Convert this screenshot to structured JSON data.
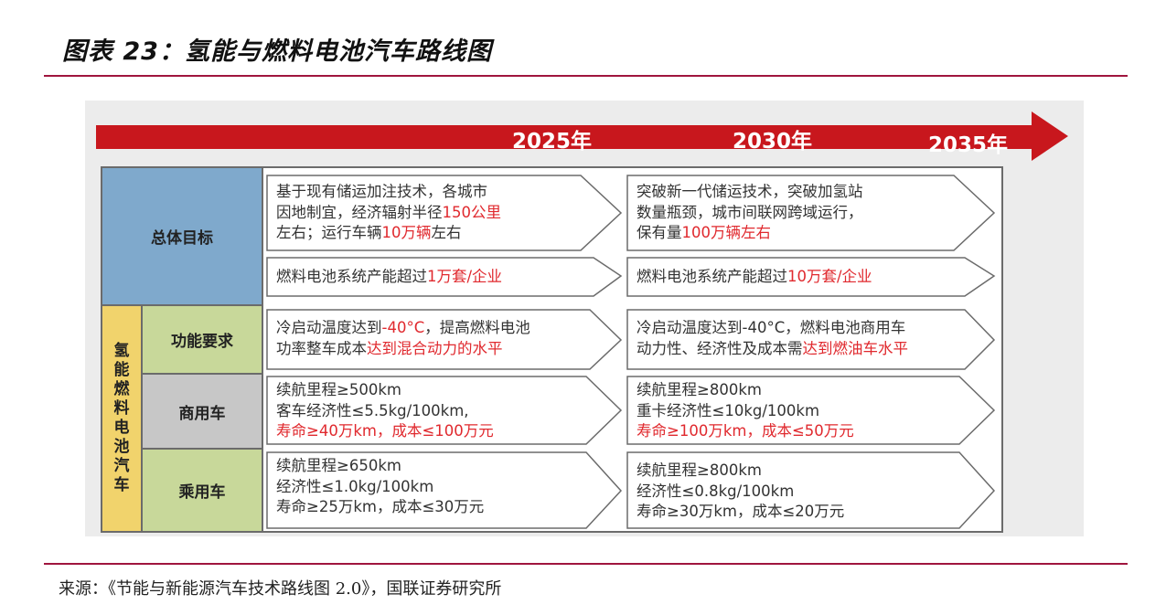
{
  "title": "图表 23：氢能与燃料电池汽车路线图",
  "source": "来源：《节能与新能源汽车技术路线图 2.0》，国联证券研究所",
  "timeline": {
    "years": [
      "2025年",
      "2030年",
      "2035年"
    ]
  },
  "rows": {
    "overall": "总体目标",
    "group_chars": [
      "氢",
      "能",
      "燃",
      "料",
      "电",
      "池",
      "汽",
      "车"
    ],
    "function": "功能要求",
    "commercial": "商用车",
    "passenger": "乘用车"
  },
  "cells": {
    "overall_a_2025": {
      "l1": "基于现有储运加注技术，各城市",
      "l2a": "因地制宜，经济辐射半径",
      "l2b": "150公里",
      "l3a": "左右；运行车辆",
      "l3b": "10万辆",
      "l3c": "左右"
    },
    "overall_a_2030": {
      "l1": "突破新一代储运技术，突破加氢站",
      "l2": "数量瓶颈，城市间联网跨域运行，",
      "l3a": "保有量",
      "l3b": "100万辆左右"
    },
    "overall_b_2025": {
      "a": "燃料电池系统产能超过",
      "b": "1万套/企业"
    },
    "overall_b_2030": {
      "a": "燃料电池系统产能超过",
      "b": "10万套/企业"
    },
    "function_2025": {
      "l1a": "冷启动温度达到",
      "l1b": "-40°C",
      "l1c": "，提高燃料电池",
      "l2a": "功率整车成本",
      "l2b": "达到混合动力的水平"
    },
    "function_2030": {
      "l1": "冷启动温度达到-40°C，燃料电池商用车",
      "l2a": "动力性、经济性及成本需",
      "l2b": "达到燃油车水平"
    },
    "commercial_2025": {
      "l1": "续航里程≥500km",
      "l2": "客车经济性≤5.5kg/100km,",
      "l3": "寿命≥40万km，成本≤100万元"
    },
    "commercial_2030": {
      "l1": "续航里程≥800km",
      "l2": "重卡经济性≤10kg/100km",
      "l3": "寿命≥100万km，成本≤50万元"
    },
    "passenger_2025": {
      "l1": "续航里程≥650km",
      "l2": "经济性≤1.0kg/100km",
      "l3": "寿命≥25万km，成本≤30万元"
    },
    "passenger_2030": {
      "l1": "续航里程≥800km",
      "l2": "经济性≤0.8kg/100km",
      "l3": "寿命≥30万km，成本≤20万元"
    }
  },
  "colors": {
    "arrow": "#c8171d",
    "rule": "#a0153e",
    "highlight": "#e0292e",
    "blue": "#7fa9cc",
    "yellow": "#f1d36c",
    "green": "#c8d89a",
    "gray": "#c7c7c7"
  }
}
